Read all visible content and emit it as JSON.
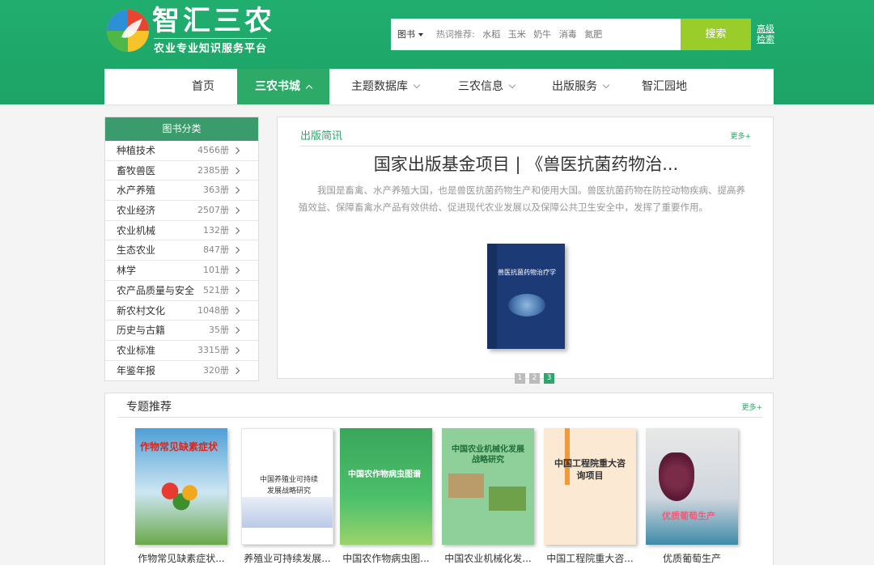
{
  "header": {
    "logo_title": "智汇三农",
    "logo_subtitle": "农业专业知识服务平台",
    "search": {
      "type_label": "图书",
      "hot_label": "热词推荐:",
      "hot_words": [
        "水稻",
        "玉米",
        "奶牛",
        "消毒",
        "氮肥"
      ],
      "button_label": "搜索"
    },
    "advanced_search": "高级检索"
  },
  "nav": {
    "items": [
      "首页",
      "三农书城",
      "主题数据库",
      "三农信息",
      "出版服务",
      "智汇园地"
    ],
    "active": "三农书城"
  },
  "sidebar": {
    "title": "图书分类",
    "categories": [
      {
        "name": "种植技术",
        "count": "4566册"
      },
      {
        "name": "畜牧兽医",
        "count": "2385册"
      },
      {
        "name": "水产养殖",
        "count": "363册"
      },
      {
        "name": "农业经济",
        "count": "2507册"
      },
      {
        "name": "农业机械",
        "count": "132册"
      },
      {
        "name": "生态农业",
        "count": "847册"
      },
      {
        "name": "林学",
        "count": "101册"
      },
      {
        "name": "农产品质量与安全",
        "count": "521册"
      },
      {
        "name": "新农村文化",
        "count": "1048册"
      },
      {
        "name": "历史与古籍",
        "count": "35册"
      },
      {
        "name": "农业标准",
        "count": "3315册"
      },
      {
        "name": "年鉴年报",
        "count": "320册"
      }
    ]
  },
  "news": {
    "section_title": "出版简讯",
    "more_label": "更多+",
    "headline": "国家出版基金项目 | 《兽医抗菌药物治...",
    "description": "我国是畜禽、水产养殖大国，也是兽医抗菌药物生产和使用大国。兽医抗菌药物在防控动物疾病、提高养殖效益、保障畜禽水产品有效供给、促进现代农业发展以及保障公共卫生安全中，发挥了重要作用。",
    "book_cover_title": "兽医抗菌药物治疗学",
    "pages": [
      "1",
      "2",
      "3"
    ],
    "active_page": "3"
  },
  "special": {
    "title": "专题推荐",
    "more_label": "更多+",
    "books": [
      {
        "caption": "作物常见缺素症状...",
        "cover_text": "作物常见缺素症状"
      },
      {
        "caption": "养殖业可持续发展...",
        "cover_text": "中国养殖业可持续发展战略研究"
      },
      {
        "caption": "中国农作物病虫图...",
        "cover_text": "中国农作物病虫图谱"
      },
      {
        "caption": "中国农业机械化发...",
        "cover_text": "中国农业机械化发展战略研究"
      },
      {
        "caption": "中国工程院重大咨...",
        "cover_text": "中国工程院重大咨询项目"
      },
      {
        "caption": "优质葡萄生产",
        "cover_text": "优质葡萄生产"
      }
    ]
  },
  "colors": {
    "header_green": "#1fa86b",
    "nav_active": "#2eaa68",
    "search_button": "#9acc2a",
    "sidebar_head": "#3c9b6c"
  }
}
